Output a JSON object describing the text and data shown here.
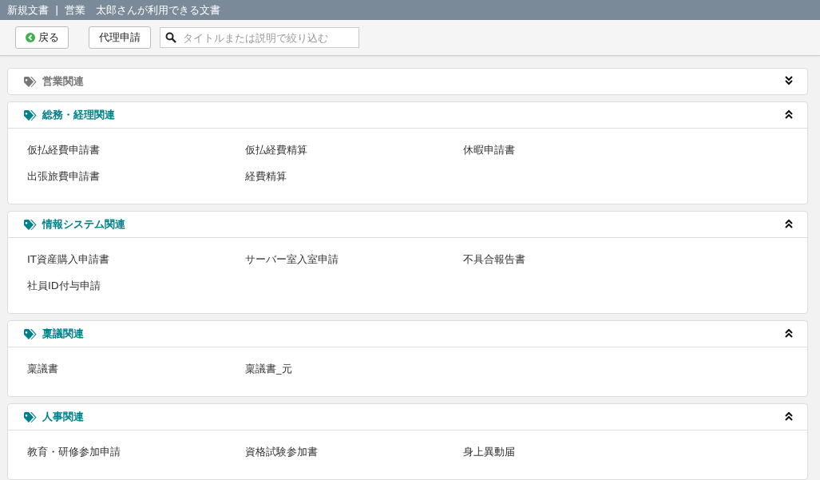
{
  "title_bar": {
    "title": "新規文書",
    "subtitle": "|",
    "context": "営業　太郎さんが利用できる文書"
  },
  "toolbar": {
    "back_button": "戻る",
    "proxy_button": "代理申請",
    "search": {
      "placeholder": "タイトルまたは説明で絞り込む"
    }
  },
  "categories": [
    {
      "title": "営業関連",
      "expanded": false
    },
    {
      "title": "総務・経理関連",
      "expanded": true,
      "documents": [
        "仮払経費申請書",
        "仮払経費精算",
        "休暇申請書",
        "出張旅費申請書",
        "経費精算"
      ]
    },
    {
      "title": "情報システム関連",
      "expanded": true,
      "documents": [
        "IT資産購入申請書",
        "サーバー室入室申請",
        "不具合報告書",
        "社員ID付与申請"
      ]
    },
    {
      "title": "稟議関連",
      "expanded": true,
      "documents": [
        "稟議書",
        "稟議書_元"
      ]
    },
    {
      "title": "人事関連",
      "expanded": true,
      "documents": [
        "教育・研修参加申請",
        "資格試験参加書",
        "身上異動届"
      ]
    }
  ]
}
